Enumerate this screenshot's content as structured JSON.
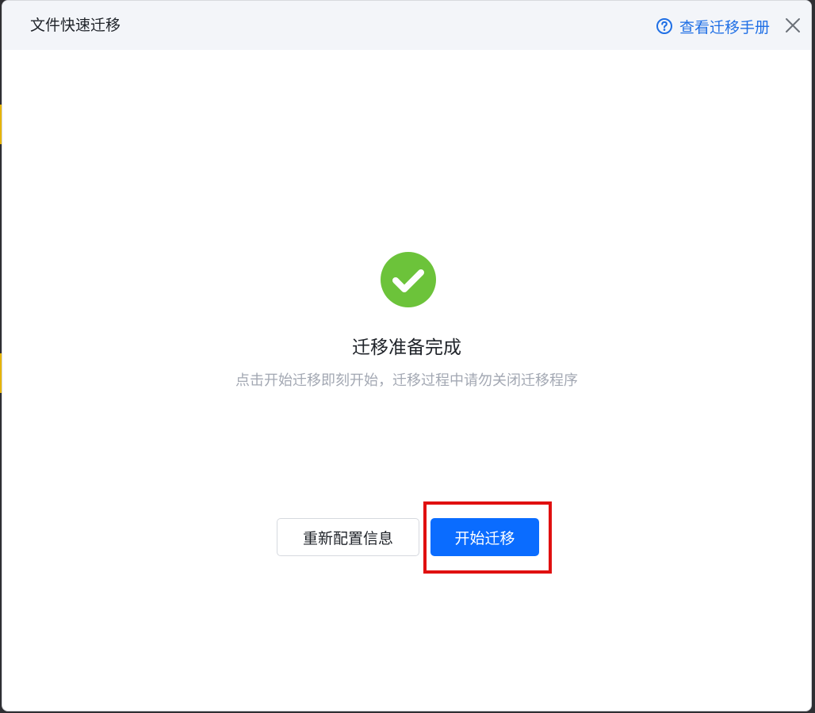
{
  "dialog": {
    "title": "文件快速迁移",
    "manual_link": "查看迁移手册"
  },
  "status": {
    "title": "迁移准备完成",
    "description": "点击开始迁移即刻开始，迁移过程中请勿关闭迁移程序"
  },
  "actions": {
    "reconfigure_label": "重新配置信息",
    "start_label": "开始迁移"
  },
  "colors": {
    "primary": "#0a6cff",
    "success": "#6cc33a",
    "link": "#1f6fe5",
    "highlight": "#e01010"
  },
  "icons": {
    "help": "help-circle-icon",
    "close": "close-icon",
    "success": "check-circle-icon"
  }
}
